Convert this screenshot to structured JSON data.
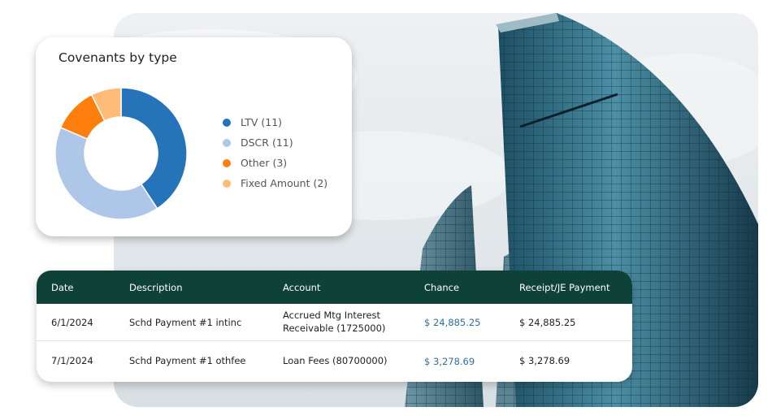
{
  "covenant_card": {
    "title": "Covenants by type",
    "legend": [
      {
        "label": "LTV (11)",
        "color": "#2573b9"
      },
      {
        "label": "DSCR (11)",
        "color": "#aec7e8"
      },
      {
        "label": "Other (3)",
        "color": "#ff7f0e"
      },
      {
        "label": "Fixed Amount (2)",
        "color": "#ffbb78"
      }
    ]
  },
  "chart_data": {
    "type": "pie",
    "title": "Covenants by type",
    "donut": true,
    "categories": [
      "LTV",
      "DSCR",
      "Other",
      "Fixed Amount"
    ],
    "values": [
      11,
      11,
      3,
      2
    ],
    "colors": [
      "#2573b9",
      "#aec7e8",
      "#ff7f0e",
      "#ffbb78"
    ],
    "legend_position": "right"
  },
  "table": {
    "headers": [
      "Date",
      "Description",
      "Account",
      "Chance",
      "Receipt/JE Payment"
    ],
    "rows": [
      {
        "date": "6/1/2024",
        "description": "Schd Payment #1 intinc",
        "account": "Accrued Mtg Interest Receivable (1725000)",
        "chance": "$ 24,885.25",
        "receipt": "$ 24,885.25"
      },
      {
        "date": "7/1/2024",
        "description": "Schd Payment #1 othfee",
        "account": "Loan Fees (80700000)",
        "chance": "$ 3,278.69",
        "receipt": "$ 3,278.69"
      }
    ]
  },
  "background": {
    "icon": "skyscraper-photo"
  }
}
